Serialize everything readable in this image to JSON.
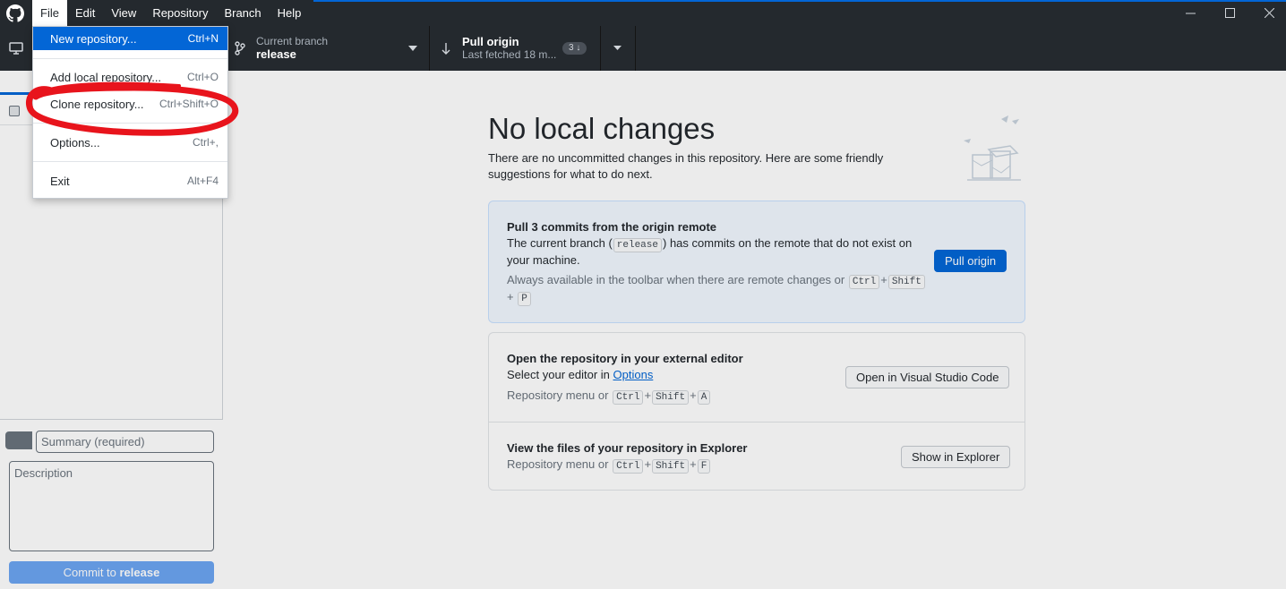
{
  "window": {
    "menus": [
      {
        "label": "File",
        "accel": "F"
      },
      {
        "label": "Edit",
        "accel": "E"
      },
      {
        "label": "View",
        "accel": "V"
      },
      {
        "label": "Repository",
        "accel": "R"
      },
      {
        "label": "Branch",
        "accel": "B"
      },
      {
        "label": "Help",
        "accel": "H"
      }
    ],
    "controls": [
      "minimize-icon",
      "maximize-icon",
      "close-icon"
    ]
  },
  "toolbar": {
    "branch_caption": "Current branch",
    "branch_name": "release",
    "pull_title": "Pull origin",
    "pull_caption": "Last fetched 18 m...",
    "pull_badge": "3 ↓"
  },
  "file_menu": {
    "items": [
      {
        "label": "New repository...",
        "shortcut": "Ctrl+N",
        "selected": true
      },
      {
        "label": "Add local repository...",
        "shortcut": "Ctrl+O"
      },
      {
        "label": "Clone repository...",
        "shortcut": "Ctrl+Shift+O"
      },
      {
        "label": "Options...",
        "shortcut": "Ctrl+,"
      },
      {
        "label": "Exit",
        "shortcut": "Alt+F4"
      }
    ]
  },
  "sidebar": {
    "summary_placeholder": "Summary (required)",
    "description_placeholder": "Description",
    "commit_prefix": "Commit to ",
    "commit_branch": "release"
  },
  "main": {
    "title": "No local changes",
    "subtitle": "There are no uncommitted changes in this repository. Here are some friendly suggestions for what to do next.",
    "pull_card": {
      "title": "Pull 3 commits from the origin remote",
      "text_before": "The current branch (",
      "branch": "release",
      "text_after": ") has commits on the remote that do not exist on your machine.",
      "hint": "Always available in the toolbar when there are remote changes or",
      "keys": [
        "Ctrl",
        "Shift",
        "P"
      ],
      "button": "Pull origin"
    },
    "editor_card": {
      "title": "Open the repository in your external editor",
      "text": "Select your editor in ",
      "link": "Options",
      "hint": "Repository menu or",
      "keys": [
        "Ctrl",
        "Shift",
        "A"
      ],
      "button": "Open in Visual Studio Code"
    },
    "explorer_card": {
      "title": "View the files of your repository in Explorer",
      "hint": "Repository menu or",
      "keys": [
        "Ctrl",
        "Shift",
        "F"
      ],
      "button": "Show in Explorer"
    }
  },
  "colors": {
    "toolbar_bg": "#24292e",
    "accent": "#0366d6",
    "annotation": "#e8141c"
  }
}
